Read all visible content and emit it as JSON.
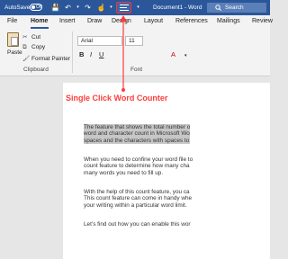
{
  "titlebar": {
    "autosave_label": "AutoSave",
    "autosave_state": "Off",
    "document_title": "Document1 - Word",
    "search_label": "Search"
  },
  "tabs": [
    {
      "label": "File"
    },
    {
      "label": "Home"
    },
    {
      "label": "Insert"
    },
    {
      "label": "Draw"
    },
    {
      "label": "Design"
    },
    {
      "label": "Layout"
    },
    {
      "label": "References"
    },
    {
      "label": "Mailings"
    },
    {
      "label": "Review"
    }
  ],
  "ribbon": {
    "paste_label": "Paste",
    "cut_label": "Cut",
    "copy_label": "Copy",
    "format_painter_label": "Format Painter",
    "clipboard_group": "Clipboard",
    "font_name": "Arial",
    "font_size": "11",
    "font_group": "Font"
  },
  "annotation": {
    "label": "Single Click Word Counter"
  },
  "document": {
    "paragraphs": [
      {
        "lines": [
          "The feature that shows the total number o",
          "word and character count in Microsoft Wo",
          "spaces and the characters with spaces to"
        ]
      },
      {
        "lines": [
          "When you need to confine your word file to",
          "count feature to determine how many cha",
          "many words you need to fill up."
        ]
      },
      {
        "lines": [
          "With the help of this count feature, you ca",
          "This count feature can come in handy whe",
          "your writing within a particular word limit."
        ]
      },
      {
        "lines": [
          "Let’s find out how you can enable this wor"
        ]
      }
    ]
  },
  "colors": {
    "titlebar": "#2b579a",
    "annotation": "#ff3b3b",
    "selection": "#c7c7c7"
  }
}
